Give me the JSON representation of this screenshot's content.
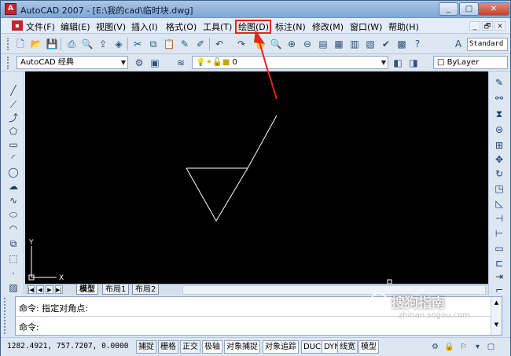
{
  "window": {
    "app_icon": "A",
    "title": "AutoCAD 2007 - [E:\\我的cad\\临时块.dwg]",
    "buttons": {
      "minimize": "_",
      "maximize": "□",
      "close": "✕"
    }
  },
  "menubar": {
    "items": [
      "文件(F)",
      "编辑(E)",
      "视图(V)",
      "插入(I)",
      "格式(O)",
      "工具(T)",
      "绘图(D)",
      "标注(N)",
      "修改(M)",
      "窗口(W)",
      "帮助(H)"
    ],
    "highlighted_item": "绘图(D)",
    "highlight_color": "#e8231c",
    "mdi_buttons": [
      "_",
      "🗗",
      "✕"
    ]
  },
  "toolbar1": {
    "style_combo": "Standard"
  },
  "toolbar2": {
    "workspace": "AutoCAD 经典",
    "layer": "0",
    "color": "ByLayer"
  },
  "canvas": {
    "background": "#000000",
    "ucs_x": "X",
    "ucs_y": "Y"
  },
  "layout_tabs": [
    "模型",
    "布局1",
    "布局2"
  ],
  "layout_nav": [
    "|◀",
    "◀",
    "▶",
    "▶|"
  ],
  "command": {
    "line1": "命令: 指定对角点:",
    "line2": "命令:"
  },
  "statusbar": {
    "coordinates": "1282.4921, 757.7207, 0.0000",
    "toggles": [
      "捕捉",
      "栅格",
      "正交",
      "极轴",
      "对象捕捉",
      "对象追踪",
      "DUCS",
      "DYN",
      "线宽",
      "模型"
    ]
  },
  "watermark": {
    "text": "搜狗指南",
    "url": "zhinan.sogou.com"
  },
  "icons": {
    "left_toolbar": [
      "line-icon",
      "construction-line-icon",
      "polyline-icon",
      "polygon-icon",
      "rectangle-icon",
      "arc-icon",
      "circle-icon",
      "revision-cloud-icon",
      "spline-icon",
      "ellipse-icon",
      "ellipse-arc-icon",
      "insert-block-icon",
      "make-block-icon",
      "point-icon",
      "hatch-icon"
    ],
    "right_toolbar": [
      "erase-icon",
      "copy-icon",
      "mirror-icon",
      "offset-icon",
      "array-icon",
      "move-icon",
      "rotate-icon",
      "scale-icon",
      "stretch-icon",
      "trim-icon",
      "extend-icon",
      "break-icon",
      "join-icon",
      "chamfer-icon",
      "fillet-icon"
    ]
  }
}
